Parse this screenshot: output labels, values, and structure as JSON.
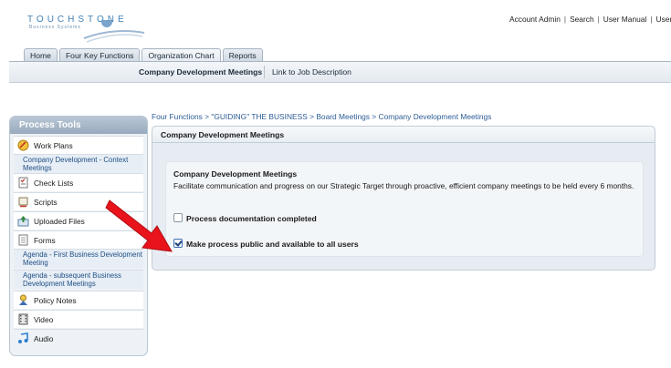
{
  "header": {
    "logo_text": "TOUCHSTONE",
    "logo_sub": "Business Systems",
    "links": [
      "Account Admin",
      "Search",
      "User Manual",
      "User S"
    ]
  },
  "tabs": [
    "Home",
    "Four Key Functions",
    "Organization Chart",
    "Reports"
  ],
  "active_tab_index": 2,
  "subnav": {
    "current": "Company Development Meetings",
    "link": "Link to Job Description"
  },
  "sidebar": {
    "title": "Process Tools",
    "sections": [
      {
        "label": "Work Plans",
        "icon": "work-plans-icon",
        "items": [
          "Company Development - Context Meetings"
        ]
      },
      {
        "label": "Check Lists",
        "icon": "checklist-icon",
        "items": []
      },
      {
        "label": "Scripts",
        "icon": "scripts-icon",
        "items": []
      },
      {
        "label": "Uploaded Files",
        "icon": "upload-icon",
        "items": []
      },
      {
        "label": "Forms",
        "icon": "forms-icon",
        "items": [
          "Agenda - First Business Development Meeting",
          "Agenda - subsequent Business Development Meetings"
        ]
      },
      {
        "label": "Policy Notes",
        "icon": "policy-icon",
        "items": []
      },
      {
        "label": "Video",
        "icon": "video-icon",
        "items": []
      },
      {
        "label": "Audio",
        "icon": "audio-icon",
        "items": []
      }
    ]
  },
  "breadcrumb": "Four Functions > \"GUIDING\" THE BUSINESS > Board Meetings > Company Development Meetings",
  "main": {
    "header": "Company Development Meetings",
    "card_title": "Company Development Meetings",
    "card_desc": "Facilitate communication and progress on our Strategic Target through proactive, efficient company meetings to be held every 6 months.",
    "checkboxes": [
      {
        "label": "Process documentation completed",
        "checked": false
      },
      {
        "label": "Make process public and available to all users",
        "checked": true
      }
    ]
  },
  "colors": {
    "accent": "#3f7fb5",
    "sidebar_header": "#97aabd",
    "arrow": "#e8131b"
  }
}
